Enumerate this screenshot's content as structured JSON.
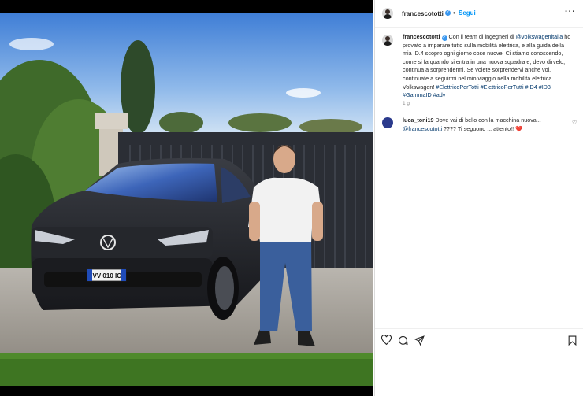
{
  "post": {
    "username": "francescototti",
    "follow_label": "Segui",
    "separator": "•",
    "more_label": "···"
  },
  "caption": {
    "username": "francescototti",
    "parts": [
      {
        "t": "text",
        "v": " Con il team di ingegneri di "
      },
      {
        "t": "mention",
        "v": "@volkswagenitalia"
      },
      {
        "t": "text",
        "v": " ho provato a imparare tutto sulla mobilità elettrica, e alla guida della mia ID.4 scopro ogni giorno cose nuove. Ci stiamo conoscendo, come si fa quando si entra in una nuova squadra e, devo dirvelo, continua a sorprendermi. Se volete sorprendervi anche voi, continuate a seguirmi nel mio viaggio nella mobilità elettrica Volkswagen! "
      },
      {
        "t": "tag",
        "v": "#ElettricoPerTotti"
      },
      {
        "t": "text",
        "v": " "
      },
      {
        "t": "tag",
        "v": "#ElettricoPerTutti"
      },
      {
        "t": "text",
        "v": " "
      },
      {
        "t": "tag",
        "v": "#ID4"
      },
      {
        "t": "text",
        "v": " "
      },
      {
        "t": "tag",
        "v": "#ID3"
      },
      {
        "t": "text",
        "v": " "
      },
      {
        "t": "tag",
        "v": "#GammaID"
      },
      {
        "t": "text",
        "v": " "
      },
      {
        "t": "tag",
        "v": "#adv"
      }
    ],
    "time_ago": "1 g"
  },
  "comment": {
    "username": "luca_toni19",
    "text1": " Dove vai di bello con la macchina nuova...",
    "mention": "@francescototti",
    "text2": " ???? Ti seguono ... attento!! ",
    "emoji": "❤️"
  },
  "car": {
    "plate": "VV 010 IO"
  },
  "icons": {
    "like": "heart-icon",
    "comment": "comment-icon",
    "share": "share-icon",
    "save": "bookmark-icon"
  }
}
